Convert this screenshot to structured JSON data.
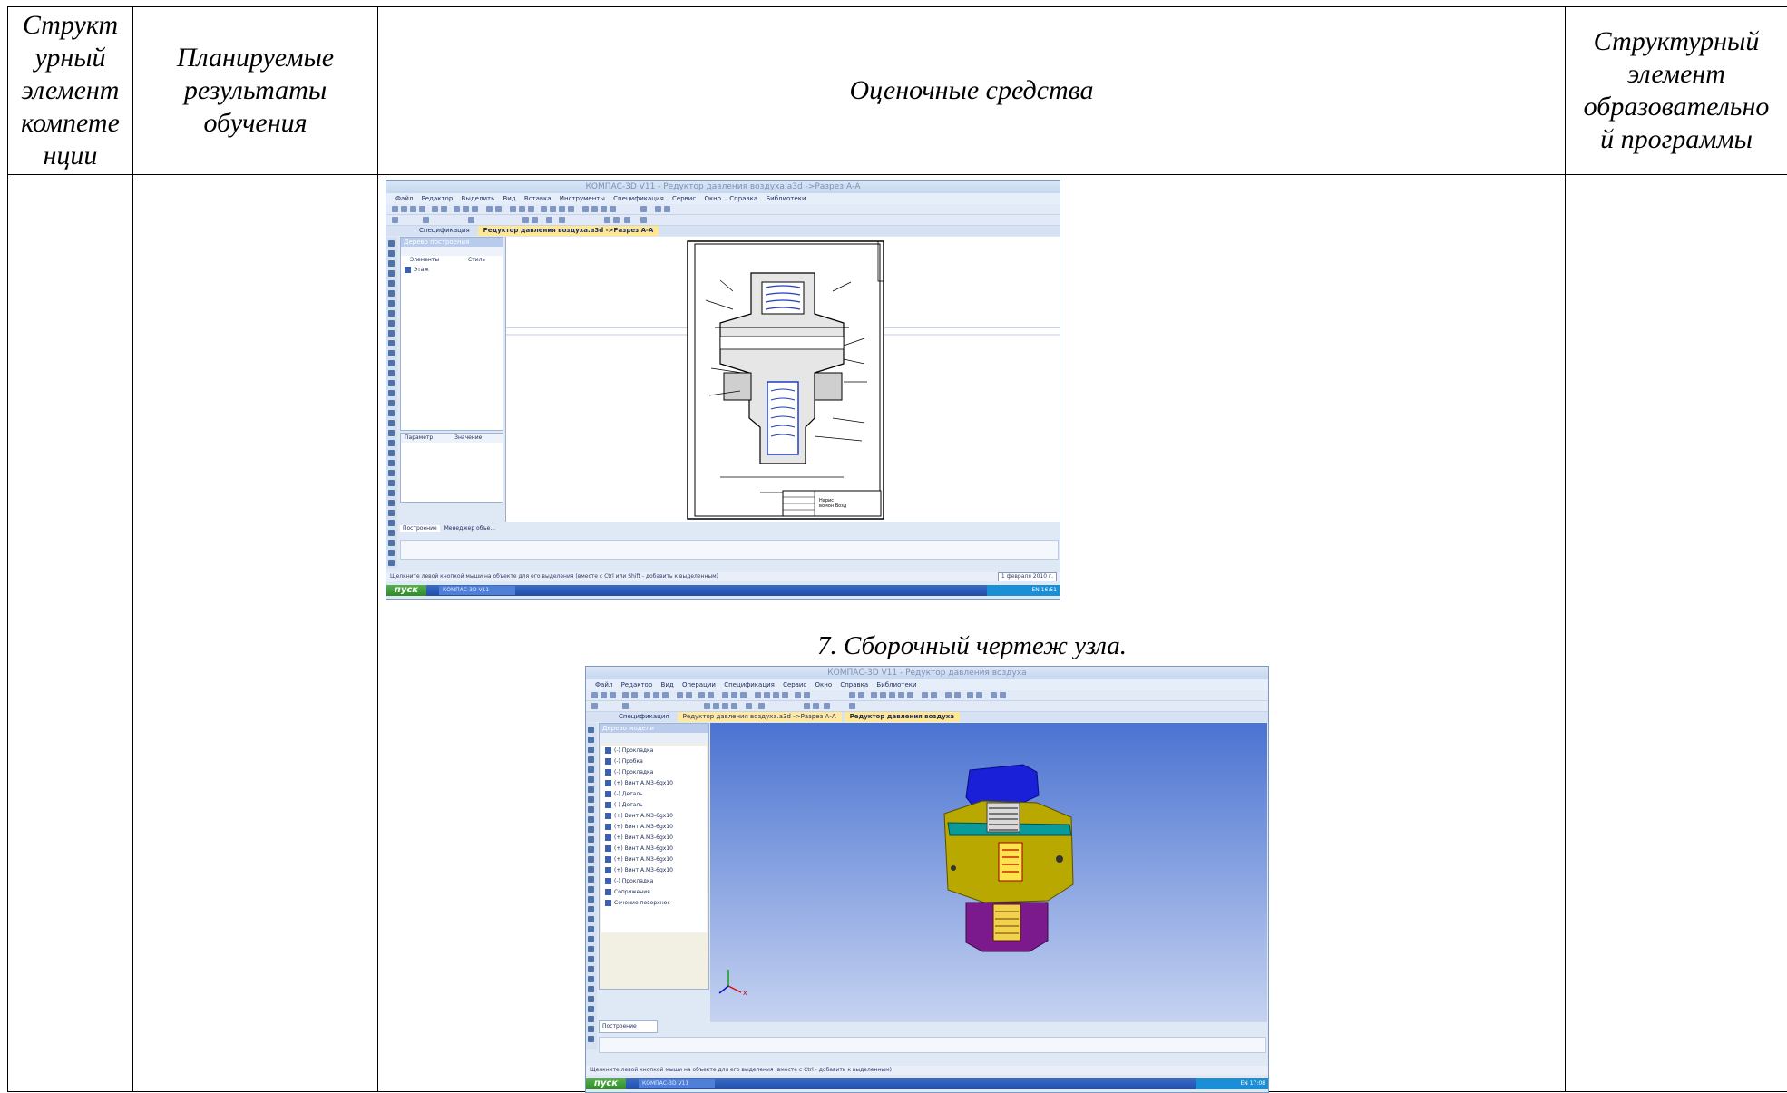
{
  "table": {
    "headers": [
      "Структурный элемент компетенции",
      "Планируемые результаты обучения",
      "Оценочные средства",
      "Структурный элемент образовательной программы"
    ],
    "header_lines": [
      [
        "Структ",
        "урный",
        "элемент",
        "компете",
        "нции"
      ],
      [
        "Планируемые",
        "результаты",
        "обучения"
      ],
      [
        "Оценочные средства"
      ],
      [
        "Структурный",
        "элемент",
        "образовательно",
        "й программы"
      ]
    ]
  },
  "caption_7": "7. Сборочный чертеж узла.",
  "screenshot1": {
    "title": "КОМПАС-3D V11 - Редуктор давления воздуха.a3d ->Разрез А-А",
    "menu": [
      "Файл",
      "Редактор",
      "Выделить",
      "Вид",
      "Вставка",
      "Инструменты",
      "Спецификация",
      "Сервис",
      "Окно",
      "Справка",
      "Библиотеки"
    ],
    "tabs": [
      "Спецификация",
      "Редуктор давления воздуха.a3d ->Разрез А-А"
    ],
    "tree_title": "Дерево построения",
    "tree_cols": [
      "Элементы",
      "Стиль"
    ],
    "tree_item": "Этаж",
    "props_cols": [
      "Параметр",
      "Значение"
    ],
    "bottom_tabs": [
      "Построение",
      "Менеджер объе..."
    ],
    "status": "Щелкните левой кнопкой мыши на объекте для его выделения (вместе с Ctrl или Shift - добавить к выделенным)",
    "date": "1 февраля 2010 г.",
    "start": "пуск",
    "task": "КОМПАС-3D V11",
    "tray": "EN 16:51",
    "stamp": "Нарис вомон Возд"
  },
  "screenshot2": {
    "title": "КОМПАС-3D V11 - Редуктор давления воздуха",
    "menu": [
      "Файл",
      "Редактор",
      "Вид",
      "Операции",
      "Спецификация",
      "Сервис",
      "Окно",
      "Справка",
      "Библиотеки"
    ],
    "tabs": [
      "Спецификация",
      "Редуктор давления воздуха.a3d ->Разрез А-А",
      "Редуктор давления воздуха"
    ],
    "tree_title": "Дерево модели",
    "tree_items": [
      "(-) Прокладка",
      "(-) Пробка",
      "(-) Прокладка",
      "(+) Винт А.М3-6gx10",
      "(-) Деталь",
      "(-) Деталь",
      "(+) Винт А.М3-6gx10",
      "(+) Винт А.М3-6gx10",
      "(+) Винт А.М3-6gx10",
      "(+) Винт А.М3-6gx10",
      "(+) Винт А.М3-6gx10",
      "(+) Винт А.М3-6gx10",
      "(-) Прокладка",
      "Сопряжения",
      "Сечение поверхнос"
    ],
    "bottom_tab": "Построение",
    "status": "Щелкните левой кнопкой мыши на объекте для его выделения (вместе с Ctrl - добавить к выделенным)",
    "start": "пуск",
    "task": "КОМПАС-3D V11",
    "tray": "EN 17:08",
    "axis_x": "x"
  },
  "colors": {
    "border": "#000000",
    "cad_blue": "#2b6ad8",
    "model_yellow": "#c8b400",
    "model_purple": "#7a1a8c"
  }
}
